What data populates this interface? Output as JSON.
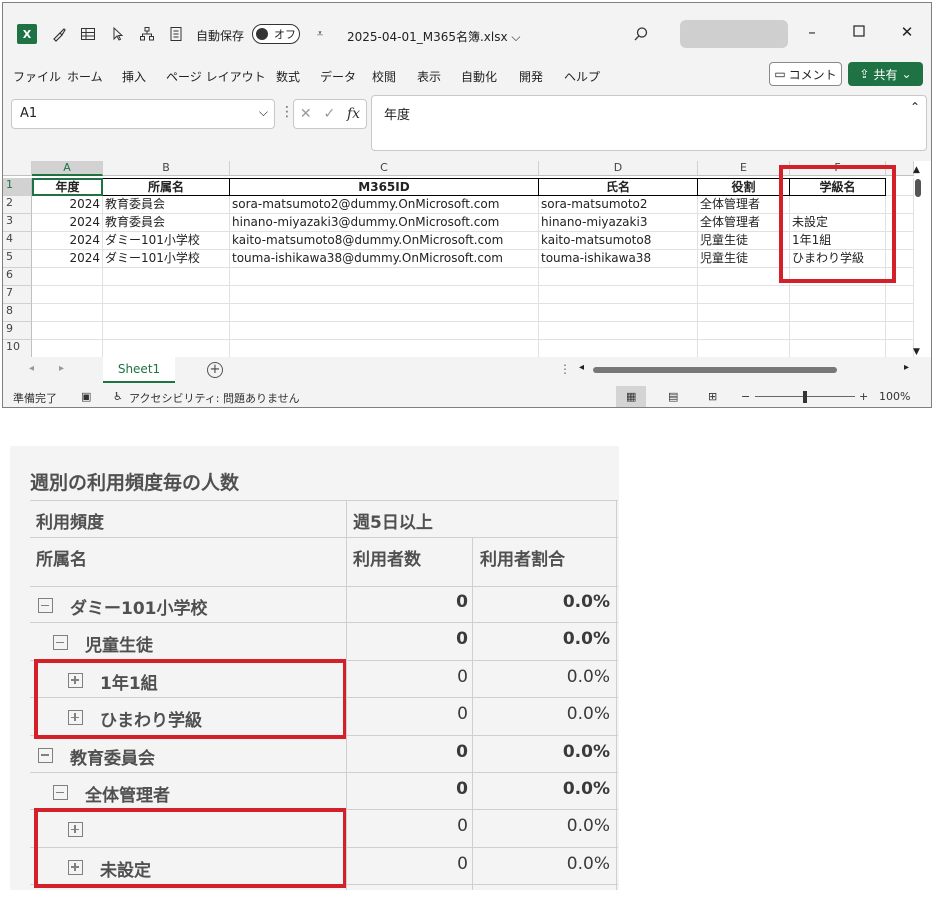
{
  "excel": {
    "autosave_label": "自動保存",
    "autosave_state": "オフ",
    "file_name": "2025-04-01_M365名簿.xlsx",
    "menu": [
      "ファイル",
      "ホーム",
      "挿入",
      "ページ レイアウト",
      "数式",
      "データ",
      "校閲",
      "表示",
      "自動化",
      "開発",
      "ヘルプ"
    ],
    "comment_label": "コメント",
    "share_label": "共有",
    "name_box": "A1",
    "formula_value": "年度",
    "columns": [
      "A",
      "B",
      "C",
      "D",
      "E",
      "F"
    ],
    "row_numbers": [
      "1",
      "2",
      "3",
      "4",
      "5",
      "6",
      "7",
      "8",
      "9",
      "10"
    ],
    "header_row": [
      "年度",
      "所属名",
      "M365ID",
      "氏名",
      "役割",
      "学級名"
    ],
    "rows": [
      [
        "2024",
        "教育委員会",
        "sora-matsumoto2@dummy.OnMicrosoft.com",
        "sora-matsumoto2",
        "全体管理者",
        ""
      ],
      [
        "2024",
        "教育委員会",
        "hinano-miyazaki3@dummy.OnMicrosoft.com",
        "hinano-miyazaki3",
        "全体管理者",
        "未設定"
      ],
      [
        "2024",
        "ダミー101小学校",
        "kaito-matsumoto8@dummy.OnMicrosoft.com",
        "kaito-matsumoto8",
        "児童生徒",
        "1年1組"
      ],
      [
        "2024",
        "ダミー101小学校",
        "touma-ishikawa38@dummy.OnMicrosoft.com",
        "touma-ishikawa38",
        "児童生徒",
        "ひまわり学級"
      ]
    ],
    "sheet_tab": "Sheet1",
    "status_ready": "準備完了",
    "status_accessibility": "アクセシビリティ: 問題ありません",
    "zoom": "100%"
  },
  "matrix": {
    "title": "週別の利用頻度毎の人数",
    "row_header_1": "利用頻度",
    "col_group": "週5日以上",
    "row_header_2": "所属名",
    "col_users": "利用者数",
    "col_ratio": "利用者割合",
    "rows": [
      {
        "label": "ダミー101小学校",
        "count": "0",
        "ratio": "0.0%",
        "level": 0,
        "expanded": true,
        "bold_values": true
      },
      {
        "label": "児童生徒",
        "count": "0",
        "ratio": "0.0%",
        "level": 1,
        "expanded": true,
        "bold_values": true
      },
      {
        "label": "1年1組",
        "count": "0",
        "ratio": "0.0%",
        "level": 2,
        "expanded": false,
        "bold_values": false
      },
      {
        "label": "ひまわり学級",
        "count": "0",
        "ratio": "0.0%",
        "level": 2,
        "expanded": false,
        "bold_values": false
      },
      {
        "label": "教育委員会",
        "count": "0",
        "ratio": "0.0%",
        "level": 0,
        "expanded": true,
        "bold_values": true
      },
      {
        "label": "全体管理者",
        "count": "0",
        "ratio": "0.0%",
        "level": 1,
        "expanded": true,
        "bold_values": true
      },
      {
        "label": "",
        "count": "0",
        "ratio": "0.0%",
        "level": 2,
        "expanded": false,
        "bold_values": false
      },
      {
        "label": "未設定",
        "count": "0",
        "ratio": "0.0%",
        "level": 2,
        "expanded": false,
        "bold_values": false
      }
    ]
  },
  "colors": {
    "excel_green": "#1f7244",
    "highlight_red": "#d42029"
  }
}
